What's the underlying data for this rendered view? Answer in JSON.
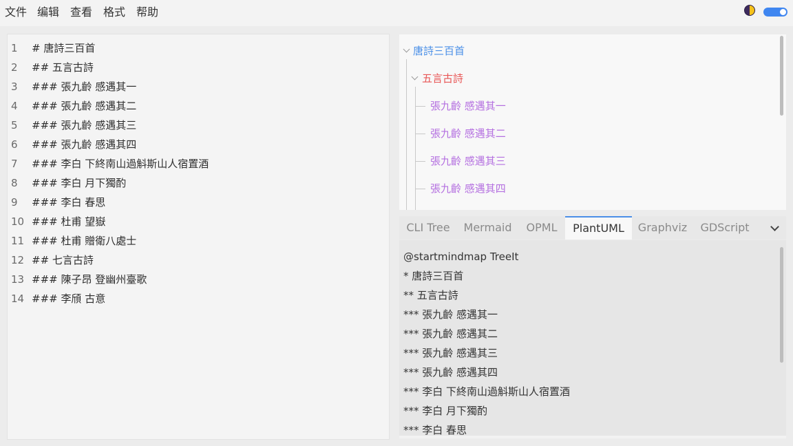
{
  "menu": {
    "file": "文件",
    "edit": "编辑",
    "view": "查看",
    "format": "格式",
    "help": "帮助"
  },
  "toolbar": {
    "theme_icon": "half-moon-icon",
    "toggle_state": "on",
    "accent_color": "#3f86f0"
  },
  "editor": {
    "lines": [
      {
        "num": "1",
        "text": "# 唐詩三百首"
      },
      {
        "num": "2",
        "text": "## 五言古詩"
      },
      {
        "num": "3",
        "text": "### 張九齡 感遇其一"
      },
      {
        "num": "4",
        "text": "### 張九齡 感遇其二"
      },
      {
        "num": "5",
        "text": "### 張九齡 感遇其三"
      },
      {
        "num": "6",
        "text": "### 張九齡 感遇其四"
      },
      {
        "num": "7",
        "text": "### 李白 下終南山過斛斯山人宿置酒"
      },
      {
        "num": "8",
        "text": "### 李白 月下獨酌"
      },
      {
        "num": "9",
        "text": "### 李白 春思"
      },
      {
        "num": "10",
        "text": "### 杜甫 望嶽"
      },
      {
        "num": "11",
        "text": "### 杜甫 贈衛八處士"
      },
      {
        "num": "12",
        "text": "## 七言古詩"
      },
      {
        "num": "13",
        "text": "### 陳子昂 登幽州臺歌"
      },
      {
        "num": "14",
        "text": "### 李頎 古意"
      }
    ]
  },
  "mindmap": {
    "root": {
      "label": "唐詩三百首",
      "color": "#4a8fe7"
    },
    "level2": {
      "label": "五言古詩",
      "color": "#e85555"
    },
    "level3": [
      {
        "label": "張九齡 感遇其一"
      },
      {
        "label": "張九齡 感遇其二"
      },
      {
        "label": "張九齡 感遇其三"
      },
      {
        "label": "張九齡 感遇其四"
      }
    ],
    "level3_color": "#b46fe0"
  },
  "tabs": {
    "items": [
      {
        "label": "CLI Tree"
      },
      {
        "label": "Mermaid"
      },
      {
        "label": "OPML"
      },
      {
        "label": "PlantUML"
      },
      {
        "label": "Graphviz"
      },
      {
        "label": "GDScript"
      }
    ],
    "active": "PlantUML",
    "dropdown_icon": "chevron-down-icon"
  },
  "output": {
    "lines": [
      "@startmindmap TreeIt",
      "* 唐詩三百首",
      "** 五言古詩",
      "*** 張九齡 感遇其一",
      "*** 張九齡 感遇其二",
      "*** 張九齡 感遇其三",
      "*** 張九齡 感遇其四",
      "*** 李白 下終南山過斛斯山人宿置酒",
      "*** 李白 月下獨酌",
      "*** 李白 春思"
    ]
  }
}
